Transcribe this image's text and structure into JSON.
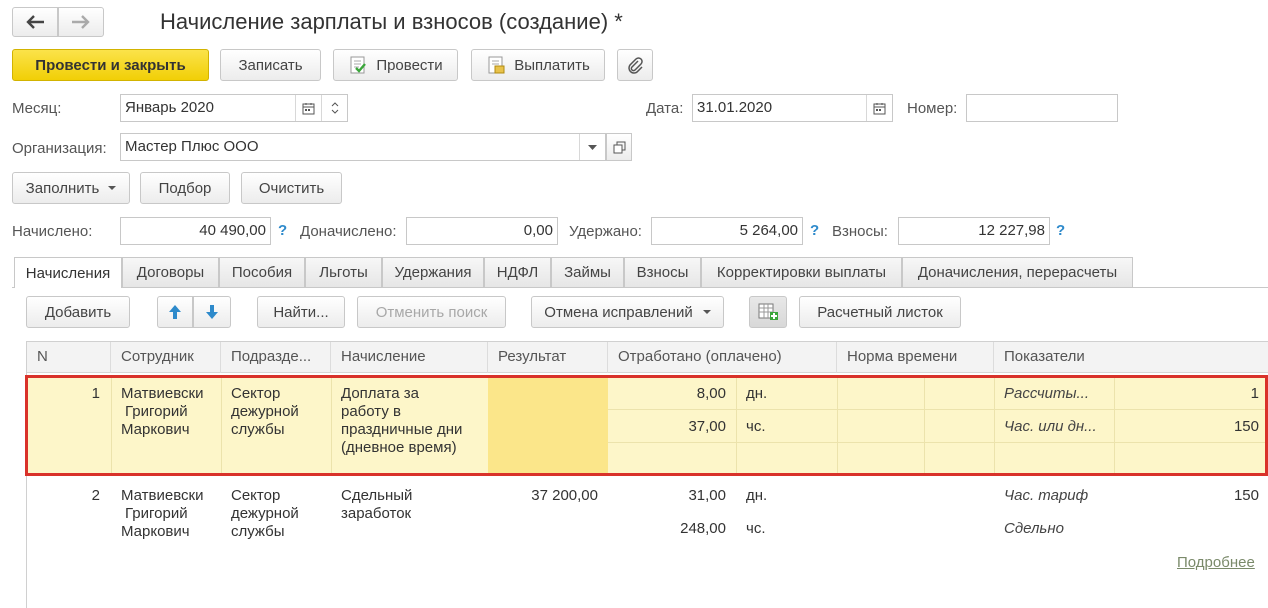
{
  "window": {
    "title": "Начисление зарплаты и взносов (создание) *"
  },
  "toolbar": {
    "post_close": "Провести и закрыть",
    "save": "Записать",
    "post": "Провести",
    "pay": "Выплатить"
  },
  "header": {
    "month_label": "Месяц:",
    "month_value": "Январь 2020",
    "date_label": "Дата:",
    "date_value": "31.01.2020",
    "number_label": "Номер:",
    "number_value": "",
    "org_label": "Организация:",
    "org_value": "Мастер Плюс ООО"
  },
  "actions": {
    "fill": "Заполнить",
    "select": "Подбор",
    "clear": "Очистить"
  },
  "totals": {
    "accrued_label": "Начислено:",
    "accrued_value": "40 490,00",
    "extra_label": "Доначислено:",
    "extra_value": "0,00",
    "withheld_label": "Удержано:",
    "withheld_value": "5 264,00",
    "contrib_label": "Взносы:",
    "contrib_value": "12 227,98",
    "help": "?"
  },
  "tabs": [
    {
      "label": "Начисления",
      "active": true
    },
    {
      "label": "Договоры"
    },
    {
      "label": "Пособия"
    },
    {
      "label": "Льготы"
    },
    {
      "label": "Удержания"
    },
    {
      "label": "НДФЛ"
    },
    {
      "label": "Займы"
    },
    {
      "label": "Взносы"
    },
    {
      "label": "Корректировки выплаты"
    },
    {
      "label": "Доначисления, перерасчеты"
    }
  ],
  "tabbar": {
    "add": "Добавить",
    "find": "Найти...",
    "cancel_search": "Отменить поиск",
    "undo_corrections": "Отмена исправлений",
    "payslip": "Расчетный листок"
  },
  "table": {
    "columns": [
      "N",
      "Сотрудник",
      "Подразде...",
      "Начисление",
      "Результат",
      "Отработано (оплачено)",
      "Норма времени",
      "Показатели"
    ],
    "rows": [
      {
        "n": "1",
        "employee": [
          "Матвиевски",
          "Григорий",
          "Маркович"
        ],
        "department": [
          "Сектор",
          "дежурной",
          "службы"
        ],
        "accrual": [
          "Доплата за",
          "работу в",
          "праздничные дни",
          "(дневное время)"
        ],
        "result": "",
        "worked1": "8,00",
        "unit1": "дн.",
        "worked2": "37,00",
        "unit2": "чс.",
        "ind1_name": "Рассчиты...",
        "ind1_value": "1",
        "ind2_name": "Час. или дн...",
        "ind2_value": "150"
      },
      {
        "n": "2",
        "employee": [
          "Матвиевски",
          "Григорий",
          "Маркович"
        ],
        "department": [
          "Сектор",
          "дежурной",
          "службы"
        ],
        "accrual": [
          "Сдельный",
          "заработок"
        ],
        "result": "37 200,00",
        "worked1": "31,00",
        "unit1": "дн.",
        "worked2": "248,00",
        "unit2": "чс.",
        "ind1_name": "Час. тариф",
        "ind1_value": "150",
        "ind2_name": "Сдельно",
        "ind2_value": ""
      }
    ]
  },
  "footer": {
    "more_link": "Подробнее"
  },
  "colors": {
    "primary_button": "#f5d60f",
    "selected_row": "#fdf6c9",
    "selected_cell": "#fbe68a",
    "highlight_border": "#d9322a",
    "link": "#7a8a6a",
    "help": "#2e8acb"
  },
  "icons": [
    "arrow-left-icon",
    "arrow-right-icon",
    "post-doc-icon",
    "pay-doc-icon",
    "paperclip-icon",
    "calendar-icon",
    "spin-icon",
    "dropdown-icon",
    "open-icon",
    "arrow-up-icon",
    "arrow-down-icon",
    "grid-add-icon"
  ]
}
